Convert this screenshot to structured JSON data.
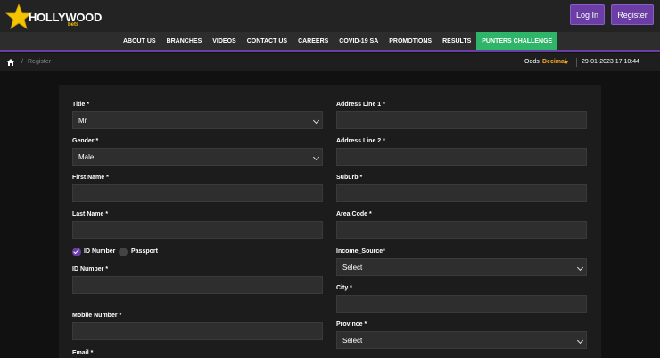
{
  "header": {
    "logo_text": "HOLLYWOOD",
    "logo_sub": "bets",
    "login_label": "Log In",
    "register_label": "Register"
  },
  "nav": {
    "items": [
      "ABOUT US",
      "BRANCHES",
      "VIDEOS",
      "CONTACT US",
      "CAREERS",
      "COVID-19 SA",
      "PROMOTIONS",
      "RESULTS",
      "PUNTERS CHALLENGE"
    ]
  },
  "breadcrumb": {
    "separator": "/",
    "current": "Register"
  },
  "odds": {
    "label": "Odds",
    "value": "Decimal"
  },
  "datetime": "29-01-2023 17:10:44",
  "form": {
    "left": {
      "title_label": "Title *",
      "title_value": "Mr",
      "gender_label": "Gender *",
      "gender_value": "Male",
      "first_name_label": "First Name *",
      "last_name_label": "Last Name *",
      "id_number_option": "ID Number",
      "passport_option": "Passport",
      "id_number_label": "ID Number *",
      "mobile_label": "Mobile Number *",
      "email_label": "Email *"
    },
    "right": {
      "address1_label": "Address Line 1 *",
      "address2_label": "Address Line 2 *",
      "suburb_label": "Suburb *",
      "area_code_label": "Area Code *",
      "income_label": "Income_Source*",
      "income_value": "Select",
      "city_label": "City *",
      "province_label": "Province *",
      "province_value": "Select"
    }
  },
  "colors": {
    "accent_purple": "#6b3ea6",
    "nav_highlight_green": "#2fb56a",
    "odds_orange": "#f5a623",
    "logo_yellow": "#f5c400"
  }
}
